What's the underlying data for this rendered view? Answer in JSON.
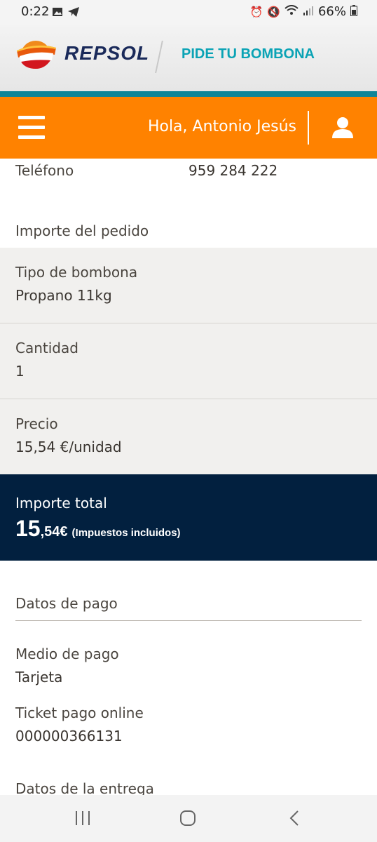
{
  "status_bar": {
    "time": "0:22",
    "battery": "66%",
    "left_icons": [
      "image-icon",
      "telegram-icon"
    ],
    "right_icons": [
      "alarm-icon",
      "mute-icon",
      "wifi-icon",
      "signal-icon",
      "battery-icon"
    ]
  },
  "brand": {
    "name": "REPSOL",
    "tagline": "PIDE TU BOMBONA",
    "colors": {
      "orange": "#ff8200",
      "teal": "#0aa3b5",
      "navy": "#1a2a5a"
    }
  },
  "nav": {
    "greeting": "Hola, Antonio Jesús",
    "menu_icon": "hamburger-icon",
    "user_icon": "user-icon"
  },
  "contact": {
    "phone_label": "Teléfono",
    "phone_value": "959 284 222"
  },
  "order": {
    "section_title": "Importe del pedido",
    "rows": [
      {
        "label": "Tipo de bombona",
        "value": "Propano 11kg"
      },
      {
        "label": "Cantidad",
        "value": "1"
      },
      {
        "label": "Precio",
        "value": "15,54 €/unidad"
      }
    ],
    "total": {
      "label": "Importe total",
      "amount_int": "15",
      "amount_dec": ",54€",
      "note": "(Impuestos incluidos)"
    }
  },
  "payment": {
    "section_title": "Datos de pago",
    "method_label": "Medio de pago",
    "method_value": "Tarjeta",
    "ticket_label": "Ticket pago online",
    "ticket_value": "000000366131"
  },
  "delivery": {
    "section_title": "Datos de la entrega"
  },
  "system_nav": {
    "items": [
      "recents-icon",
      "home-icon",
      "back-icon"
    ]
  }
}
